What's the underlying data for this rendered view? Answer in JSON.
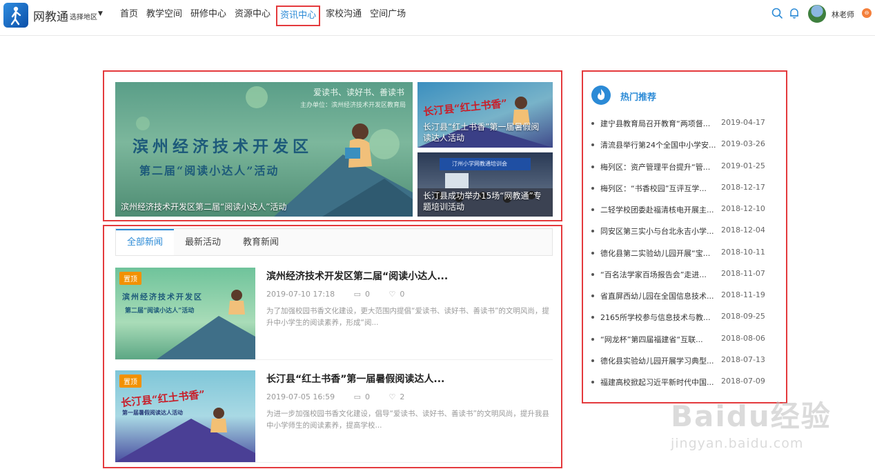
{
  "header": {
    "brand": "网教通",
    "region_label": "选择地区",
    "nav": [
      "首页",
      "教学空间",
      "研修中心",
      "资源中心",
      "资讯中心",
      "家校沟通",
      "空间广场"
    ],
    "active_nav": "资讯中心",
    "user_name": "林老师"
  },
  "carousel": {
    "main": {
      "caption": "滨州经济技术开发区第二届“阅读小达人”活动",
      "poster_line1": "滨州经济技术开发区",
      "poster_line2": "第二届“阅读小达人”活动",
      "poster_slogan": "爱读书、读好书、善读书",
      "poster_org": "主办单位：滨州经济技术开发区教育局"
    },
    "side": [
      {
        "caption": "长汀县“红土书香”第一届暑假阅读达人活动",
        "poster_text": "长汀县“红土书香”"
      },
      {
        "caption": "长汀县成功举办15场“网教通”专题培训活动",
        "poster_text": "汀州小学网教通培训会"
      }
    ]
  },
  "tabs": [
    "全部新闻",
    "最新活动",
    "教育新闻"
  ],
  "news": [
    {
      "badge": "置顶",
      "title": "滨州经济技术开发区第二届“阅读小达人...",
      "time": "2019-07-10 17:18",
      "comments": "0",
      "likes": "0",
      "summary": "为了加强校园书香文化建设，更大范围内提倡“爱读书、读好书、善读书”的文明风尚，提升中小学生的阅读素养，形成“阅...",
      "thumb_line1": "滨州经济技术开发区",
      "thumb_line2": "第二届“阅读小达人”活动"
    },
    {
      "badge": "置顶",
      "title": "长汀县“红土书香”第一届暑假阅读达人...",
      "time": "2019-07-05 16:59",
      "comments": "0",
      "likes": "2",
      "summary": "为进一步加强校园书香文化建设，倡导“爱读书、读好书、善读书”的文明风尚，提升我县中小学师生的阅读素养，提高学校...",
      "thumb_line1": "长汀县“红土书香”",
      "thumb_line2": "第一届暑假阅读达人活动"
    }
  ],
  "hot": {
    "title": "热门推荐",
    "items": [
      {
        "title": "建宁县教育局召开教育“两项督...",
        "date": "2019-04-17"
      },
      {
        "title": "清流县举行第24个全国中小学安...",
        "date": "2019-03-26"
      },
      {
        "title": "梅列区：资产管理平台提升“管...",
        "date": "2019-01-25"
      },
      {
        "title": "梅列区：“书香校园”互评互学...",
        "date": "2018-12-17"
      },
      {
        "title": "二轻学校团委赴福清核电开展主...",
        "date": "2018-12-10"
      },
      {
        "title": "同安区第三实小与台北永吉小学...",
        "date": "2018-12-04"
      },
      {
        "title": "德化县第二实验幼儿园开展“宝...",
        "date": "2018-10-11"
      },
      {
        "title": "“百名法学家百场报告会”走进...",
        "date": "2018-11-07"
      },
      {
        "title": "省直屏西幼儿园在全国信息技术...",
        "date": "2018-11-19"
      },
      {
        "title": "2165所学校参与信息技术与教...",
        "date": "2018-09-25"
      },
      {
        "title": "“网龙杯”第四届福建省“互联...",
        "date": "2018-08-06"
      },
      {
        "title": "德化县实验幼儿园开展学习典型...",
        "date": "2018-07-13"
      },
      {
        "title": "福建高校掀起习近平新时代中国...",
        "date": "2018-07-09"
      }
    ]
  },
  "watermark": {
    "main": "Baidu经验",
    "sub": "jingyan.baidu.com"
  },
  "colors": {
    "accent": "#2b8ad6",
    "highlight_border": "#e4393c",
    "pin_badge": "#f29100"
  }
}
